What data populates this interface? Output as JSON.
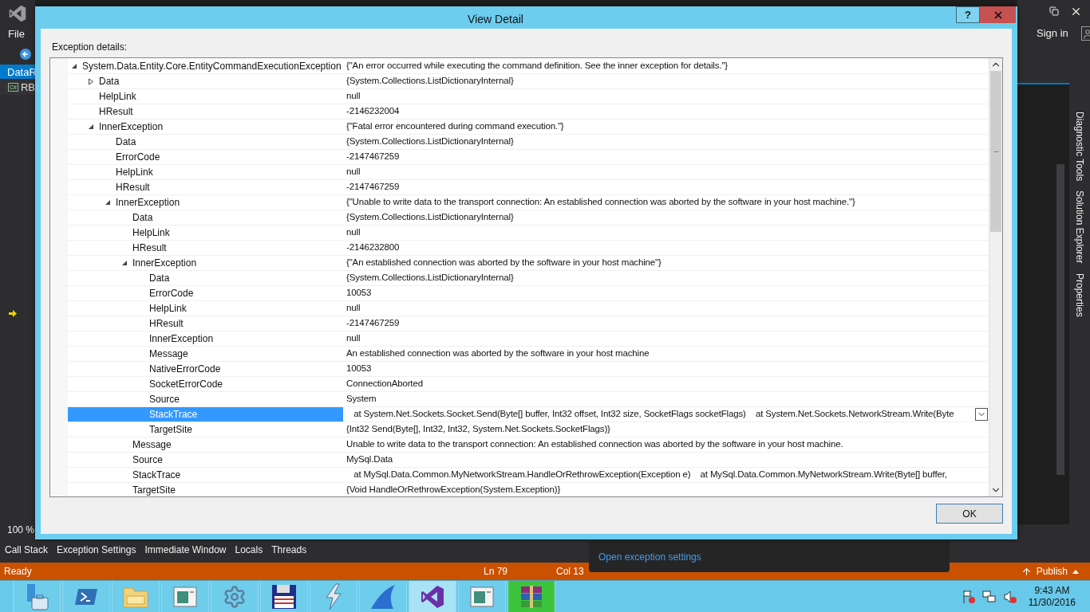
{
  "vs": {
    "menu": "File",
    "doc_tab": {
      "label": "DataR",
      "selected": true
    },
    "file_tab": {
      "label": "RB",
      "badge": "C#",
      "selected": false
    },
    "zoom": "100 %",
    "sign_in": "Sign in",
    "side_tabs": [
      "Diagnostic Tools",
      "Solution Explorer",
      "Properties"
    ]
  },
  "dialog": {
    "title": "View Detail",
    "help": "?",
    "label": "Exception details:",
    "ok": "OK",
    "tree": [
      {
        "name": "System.Data.Entity.Core.EntityCommandExecutionException",
        "value": "{\"An error occurred while executing the command definition. See the inner exception for details.\"}",
        "expanded": true,
        "selected": false,
        "children": [
          {
            "name": "Data",
            "value": "{System.Collections.ListDictionaryInternal}",
            "expanded": false,
            "selected": false
          },
          {
            "name": "HelpLink",
            "value": "null",
            "selected": false
          },
          {
            "name": "HResult",
            "value": "-2146232004",
            "selected": false
          },
          {
            "name": "InnerException",
            "value": "{\"Fatal error encountered during command execution.\"}",
            "expanded": true,
            "selected": false,
            "children": [
              {
                "name": "Data",
                "value": "{System.Collections.ListDictionaryInternal}",
                "selected": false
              },
              {
                "name": "ErrorCode",
                "value": "-2147467259",
                "selected": false
              },
              {
                "name": "HelpLink",
                "value": "null",
                "selected": false
              },
              {
                "name": "HResult",
                "value": "-2147467259",
                "selected": false
              },
              {
                "name": "InnerException",
                "value": "{\"Unable to write data to the transport connection: An established connection was aborted by the software in your host machine.\"}",
                "expanded": true,
                "selected": false,
                "children": [
                  {
                    "name": "Data",
                    "value": "{System.Collections.ListDictionaryInternal}",
                    "selected": false
                  },
                  {
                    "name": "HelpLink",
                    "value": "null",
                    "selected": false
                  },
                  {
                    "name": "HResult",
                    "value": "-2146232800",
                    "selected": false
                  },
                  {
                    "name": "InnerException",
                    "value": "{\"An established connection was aborted by the software in your host machine\"}",
                    "expanded": true,
                    "selected": false,
                    "children": [
                      {
                        "name": "Data",
                        "value": "{System.Collections.ListDictionaryInternal}",
                        "selected": false
                      },
                      {
                        "name": "ErrorCode",
                        "value": "10053",
                        "selected": false
                      },
                      {
                        "name": "HelpLink",
                        "value": "null",
                        "selected": false
                      },
                      {
                        "name": "HResult",
                        "value": "-2147467259",
                        "selected": false
                      },
                      {
                        "name": "InnerException",
                        "value": "null",
                        "selected": false
                      },
                      {
                        "name": "Message",
                        "value": "An established connection was aborted by the software in your host machine",
                        "selected": false
                      },
                      {
                        "name": "NativeErrorCode",
                        "value": "10053",
                        "selected": false
                      },
                      {
                        "name": "SocketErrorCode",
                        "value": "ConnectionAborted",
                        "selected": false
                      },
                      {
                        "name": "Source",
                        "value": "System",
                        "selected": false
                      },
                      {
                        "name": "StackTrace",
                        "value": "   at System.Net.Sockets.Socket.Send(Byte[] buffer, Int32 offset, Int32 size, SocketFlags socketFlags)    at System.Net.Sockets.NetworkStream.Write(Byte",
                        "selected": true
                      },
                      {
                        "name": "TargetSite",
                        "value": "{Int32 Send(Byte[], Int32, Int32, System.Net.Sockets.SocketFlags)}",
                        "selected": false
                      }
                    ]
                  },
                  {
                    "name": "Message",
                    "value": "Unable to write data to the transport connection: An established connection was aborted by the software in your host machine.",
                    "selected": false
                  },
                  {
                    "name": "Source",
                    "value": "MySql.Data",
                    "selected": false
                  },
                  {
                    "name": "StackTrace",
                    "value": "   at MySql.Data.Common.MyNetworkStream.HandleOrRethrowException(Exception e)    at MySql.Data.Common.MyNetworkStream.Write(Byte[] buffer,",
                    "selected": false
                  },
                  {
                    "name": "TargetSite",
                    "value": "{Void HandleOrRethrowException(System.Exception)}",
                    "selected": false
                  }
                ]
              }
            ]
          }
        ]
      }
    ]
  },
  "tool_tabs": [
    "Call Stack",
    "Exception Settings",
    "Immediate Window",
    "Locals",
    "Threads"
  ],
  "popup": {
    "link": "Open exception settings"
  },
  "status_bar": {
    "ready": "Ready",
    "line": "Ln 79",
    "col": "Col 13",
    "publish": "Publish"
  },
  "taskbar": [
    {
      "kind": "server",
      "selected": false
    },
    {
      "kind": "shell",
      "selected": false
    },
    {
      "kind": "folder",
      "selected": false
    },
    {
      "kind": "window",
      "selected": false
    },
    {
      "kind": "gears",
      "selected": false
    },
    {
      "kind": "floppy",
      "selected": false
    },
    {
      "kind": "bolt",
      "selected": false
    },
    {
      "kind": "fin",
      "selected": false
    },
    {
      "kind": "studio",
      "selected": true
    },
    {
      "kind": "window",
      "selected": false
    },
    {
      "kind": "books",
      "selected": false
    }
  ],
  "tray": {
    "time": "9:43 AM",
    "date": "11/30/2016"
  }
}
